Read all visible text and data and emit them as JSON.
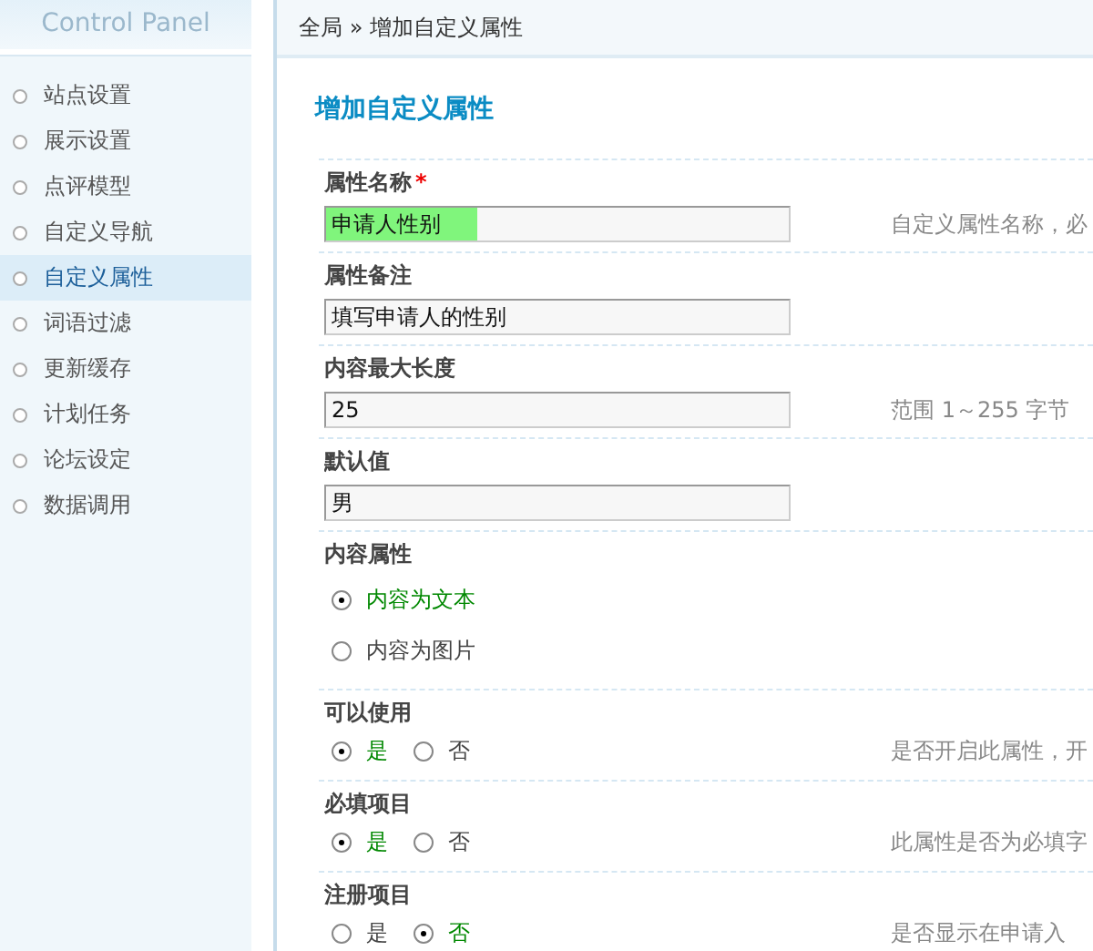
{
  "sidebar": {
    "logo": "Control Panel",
    "items": [
      {
        "label": "站点设置",
        "selected": false
      },
      {
        "label": "展示设置",
        "selected": false
      },
      {
        "label": "点评模型",
        "selected": false
      },
      {
        "label": "自定义导航",
        "selected": false
      },
      {
        "label": "自定义属性",
        "selected": true
      },
      {
        "label": "词语过滤",
        "selected": false
      },
      {
        "label": "更新缓存",
        "selected": false
      },
      {
        "label": "计划任务",
        "selected": false
      },
      {
        "label": "论坛设定",
        "selected": false
      },
      {
        "label": "数据调用",
        "selected": false
      }
    ]
  },
  "breadcrumb": "全局 » 增加自定义属性",
  "heading": "增加自定义属性",
  "fields": [
    {
      "kind": "text",
      "label": "属性名称",
      "required_mark": "*",
      "value": "申请人性别",
      "text_selected": true,
      "hint": "自定义属性名称，必"
    },
    {
      "kind": "text",
      "label": "属性备注",
      "value": "填写申请人的性别",
      "text_selected": false
    },
    {
      "kind": "text",
      "label": "内容最大长度",
      "value": "25",
      "text_selected": false,
      "hint": "范围  1～255 字节"
    },
    {
      "kind": "text",
      "label": "默认值",
      "value": "男",
      "text_selected": false
    },
    {
      "kind": "radio-stack",
      "label": "内容属性",
      "options": [
        {
          "label": "内容为文本",
          "selected": true
        },
        {
          "label": "内容为图片",
          "selected": false
        }
      ]
    },
    {
      "kind": "radio-inline",
      "label": "可以使用",
      "options": [
        {
          "label": "是",
          "selected": true
        },
        {
          "label": "否",
          "selected": false
        }
      ],
      "hint": "是否开启此属性，开"
    },
    {
      "kind": "radio-inline",
      "label": "必填项目",
      "options": [
        {
          "label": "是",
          "selected": true
        },
        {
          "label": "否",
          "selected": false
        }
      ],
      "hint": "此属性是否为必填字"
    },
    {
      "kind": "radio-inline",
      "label": "注册项目",
      "options": [
        {
          "label": "是",
          "selected": false
        },
        {
          "label": "否",
          "selected": true
        }
      ],
      "hint": "是否显示在申请入"
    }
  ]
}
